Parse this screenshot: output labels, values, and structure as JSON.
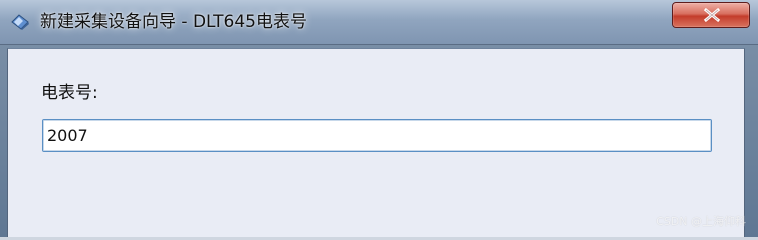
{
  "window": {
    "title": "新建采集设备向导 - DLT645电表号",
    "icon": "diamond-app-icon"
  },
  "titlebar": {
    "close_icon": "close-x-icon"
  },
  "form": {
    "label": "电表号:",
    "value": "2007"
  },
  "watermark": "CSDN @上海仰科",
  "colors": {
    "titlebar_top": "#b7c7da",
    "titlebar_bottom": "#7f95b1",
    "close_red": "#c33c2b",
    "panel_background": "#e9ecf5",
    "input_border": "#5a8fc4"
  }
}
